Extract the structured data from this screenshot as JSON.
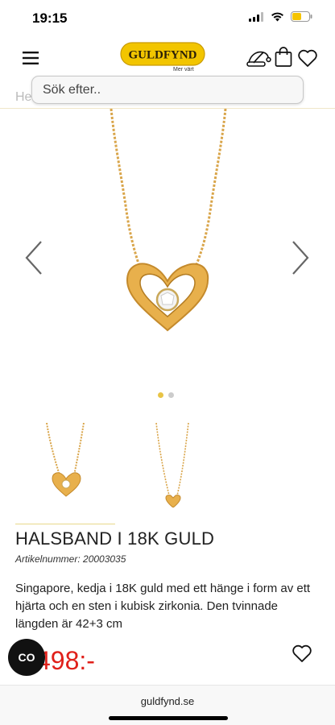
{
  "status_bar": {
    "time": "19:15",
    "battery_color": "#f5c400"
  },
  "header": {
    "logo_text": "GULDFYND",
    "logo_tagline": "Mer värt",
    "brand_color": "#f2c500"
  },
  "search": {
    "placeholder": "Sök efter.."
  },
  "breadcrumb": {
    "first_item": "Hem"
  },
  "gallery": {
    "image_count": 2,
    "active_index": 0
  },
  "product": {
    "title": "HALSBAND I 18K GULD",
    "article_number": "Artikelnummer: 20003035",
    "description": "Singapore, kedja i 18K guld med ett hänge i form av ett hjärta och en sten i kubisk zirkonia. Den tvinnade längden är 42+3 cm",
    "price": "498:-",
    "price_color": "#e0201a"
  },
  "chat": {
    "label": "CO"
  },
  "browser": {
    "domain": "guldfynd.se"
  }
}
